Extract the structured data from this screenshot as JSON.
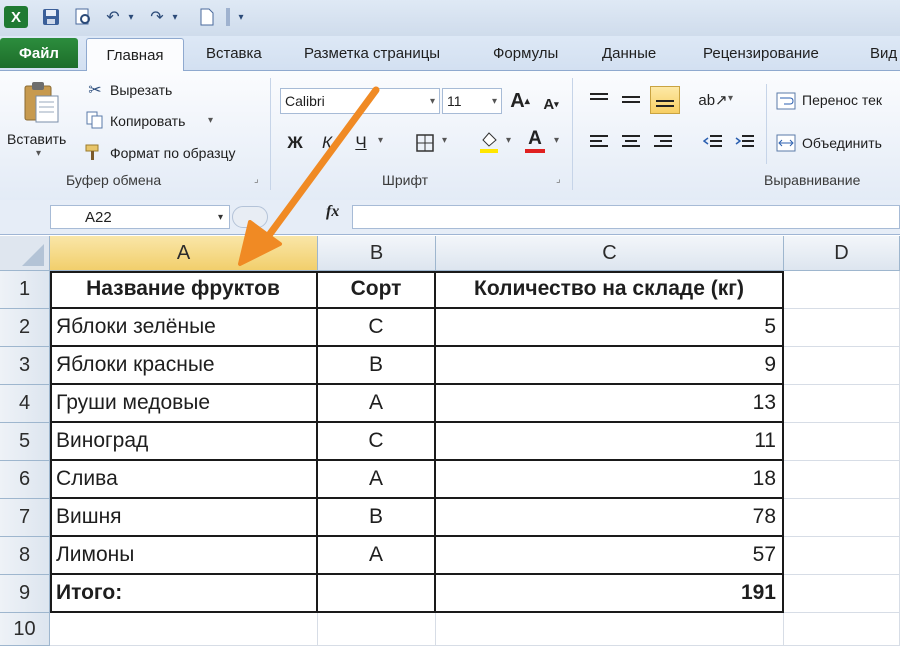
{
  "quick_access": {
    "icons": [
      "excel-logo-icon",
      "save-icon",
      "print-preview-icon",
      "undo-icon",
      "redo-icon",
      "new-document-icon"
    ]
  },
  "tabs": {
    "file": "Файл",
    "home": "Главная",
    "insert": "Вставка",
    "page_layout": "Разметка страницы",
    "formulas": "Формулы",
    "data": "Данные",
    "review": "Рецензирование",
    "view": "Вид"
  },
  "ribbon": {
    "clipboard": {
      "paste": "Вставить",
      "cut": "Вырезать",
      "copy": "Копировать",
      "format_painter": "Формат по образцу",
      "group_label": "Буфер обмена"
    },
    "font": {
      "font_name": "Calibri",
      "font_size": "11",
      "bold": "Ж",
      "italic": "К",
      "underline": "Ч",
      "group_label": "Шрифт"
    },
    "alignment": {
      "wrap_text": "Перенос тек",
      "merge": "Объединить",
      "group_label": "Выравнивание"
    },
    "accent_colors": {
      "file_tab": "#1d6d2a",
      "selected_header": "#f2cf6c",
      "arrow": "#f08a24"
    }
  },
  "formula_bar": {
    "name_box": "A22",
    "fx": "fx",
    "value": ""
  },
  "sheet": {
    "columns": [
      "A",
      "B",
      "C",
      "D"
    ],
    "selected_column": "A",
    "row_numbers": [
      "1",
      "2",
      "3",
      "4",
      "5",
      "6",
      "7",
      "8",
      "9",
      "10"
    ],
    "headers": [
      "Название фруктов",
      "Сорт",
      "Количество на складе (кг)"
    ],
    "rows": [
      {
        "name": "Яблоки зелёные",
        "grade": "C",
        "qty": "5"
      },
      {
        "name": "Яблоки красные",
        "grade": "B",
        "qty": "9"
      },
      {
        "name": "Груши медовые",
        "grade": "A",
        "qty": "13"
      },
      {
        "name": "Виноград",
        "grade": "C",
        "qty": "11"
      },
      {
        "name": "Слива",
        "grade": "A",
        "qty": "18"
      },
      {
        "name": "Вишня",
        "grade": "B",
        "qty": "78"
      },
      {
        "name": "Лимоны",
        "grade": "A",
        "qty": "57"
      }
    ],
    "total_label": "Итого:",
    "total_value": "191"
  }
}
